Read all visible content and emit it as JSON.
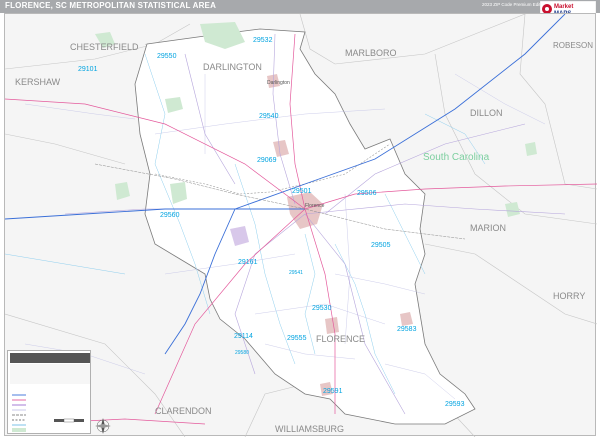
{
  "title": "FLORENCE, SC METROPOLITAN STATISTICAL AREA",
  "edition": "2023 ZIP Code Premium Edition",
  "logo": {
    "line1": "Market",
    "line2": "MAPS"
  },
  "colors": {
    "title_bar": "#a7a9ac",
    "county_fill": "#ffffff",
    "outside_fill": "#f5f5f5",
    "zip_label": "#00a3e0",
    "county_label": "#8a8a8a",
    "state_label": "#7ccf9f",
    "interstate": "#3a6fd8",
    "us_highway": "#e03a8c",
    "state_road": "#9a6fd0",
    "water": "#6fbde6"
  },
  "counties": [
    {
      "name": "CHESTERFIELD"
    },
    {
      "name": "MARLBORO"
    },
    {
      "name": "ROBESON"
    },
    {
      "name": "KERSHAW"
    },
    {
      "name": "DARLINGTON"
    },
    {
      "name": "DILLON"
    },
    {
      "name": "MARION"
    },
    {
      "name": "HORRY"
    },
    {
      "name": "CLARENDON"
    },
    {
      "name": "WILLIAMSBURG"
    },
    {
      "name": "FLORENCE"
    }
  ],
  "state_label": "South Carolina",
  "zips": [
    "29550",
    "29101",
    "29532",
    "29540",
    "29069",
    "29506",
    "29505",
    "29161",
    "29541",
    "29530",
    "29114",
    "29583",
    "29501",
    "29560",
    "29555",
    "29591",
    "29593",
    "29580"
  ],
  "place_labels": [
    "Florence",
    "Darlington"
  ]
}
